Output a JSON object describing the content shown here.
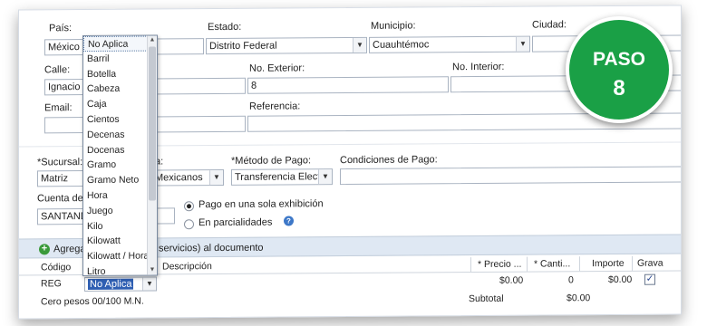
{
  "address": {
    "pais_label": "País:",
    "pais_value": "México",
    "estado_label": "Estado:",
    "estado_value": "Distrito Federal",
    "municipio_label": "Municipio:",
    "municipio_value": "Cuauhtémoc",
    "ciudad_label": "Ciudad:",
    "calle_label": "Calle:",
    "calle_value": "Ignacio M",
    "no_exterior_label": "No. Exterior:",
    "no_exterior_value": "8",
    "no_interior_label": "No. Interior:",
    "email_label": "Email:",
    "referencia_label": "Referencia:"
  },
  "payment": {
    "sucursal_label": "*Sucursal:",
    "sucursal_value": "Matriz",
    "moneda_label_partial": "a:",
    "moneda_value_partial": "Mexicanos",
    "metodo_label": "*Método de Pago:",
    "metodo_value": "Transferencia Electró",
    "condiciones_label": "Condiciones de Pago:",
    "cuenta_label": "Cuenta de P",
    "cuenta_value": "SANTANDE",
    "pago_unico_label": "Pago en una sola exhibición",
    "parcialidades_label": "En parcialidades"
  },
  "dropdown": {
    "items": [
      "No Aplica",
      "Barril",
      "Botella",
      "Cabeza",
      "Caja",
      "Cientos",
      "Decenas",
      "Docenas",
      "Gramo",
      "Gramo Neto",
      "Hora",
      "Juego",
      "Kilo",
      "Kilowatt",
      "Kilowatt / Hora",
      "Litro"
    ]
  },
  "toolbar": {
    "agregar_label_a": "Agregar",
    "agregar_label_b": "servicios) al documento"
  },
  "table": {
    "headers": {
      "codigo": "Código",
      "descripcion": "Descripción",
      "precio": "* Precio ...",
      "cantidad": "* Canti...",
      "importe": "Importe",
      "grava": "Grava"
    },
    "row": {
      "codigo": "REG",
      "unidad": "No Aplica",
      "precio": "$0.00",
      "cantidad": "0",
      "importe": "$0.00"
    },
    "total_words": "Cero pesos 00/100 M.N.",
    "subtotal_label": "Subtotal",
    "subtotal_value": "$0.00"
  },
  "badge": {
    "line1": "PASO",
    "line2": "8",
    "color": "#1aa046"
  }
}
